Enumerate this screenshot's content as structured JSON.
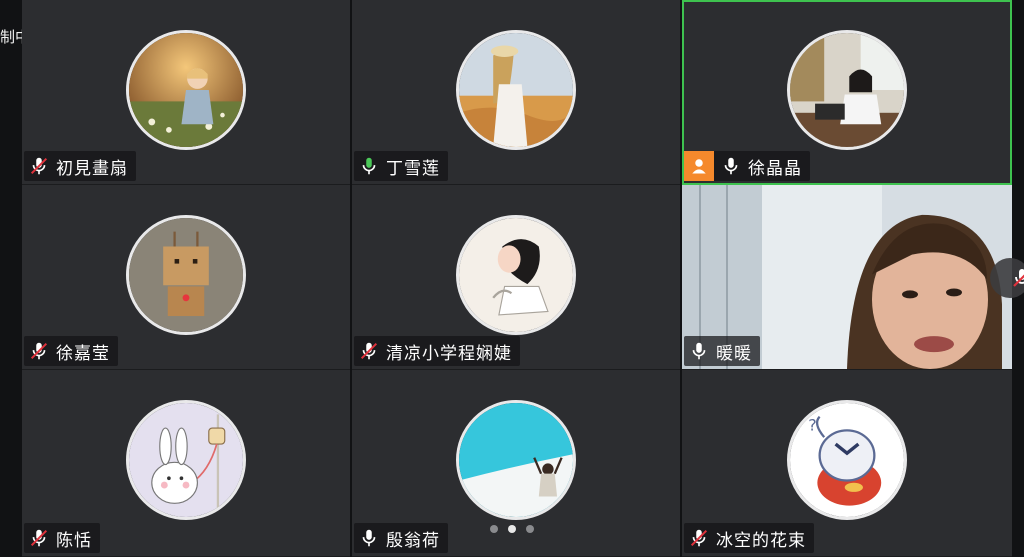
{
  "recording_label": "制中",
  "participants": [
    {
      "name": "初見畫扇",
      "mic": "muted",
      "avatar": "girl-autumn-field"
    },
    {
      "name": "丁雪莲",
      "mic": "on",
      "avatar": "woman-wheat-field"
    },
    {
      "name": "徐晶晶",
      "mic": "on",
      "avatar": "woman-office",
      "host": true,
      "active_speaker": true
    },
    {
      "name": "徐嘉莹",
      "mic": "muted",
      "avatar": "cardboard-robot"
    },
    {
      "name": "清凉小学程娴婕",
      "mic": "muted",
      "avatar": "cartoon-girl-stretch"
    },
    {
      "name": "暖暖",
      "mic": "on",
      "video": "live-camera"
    },
    {
      "name": "陈恬",
      "mic": "muted",
      "avatar": "bunny-drip"
    },
    {
      "name": "殷翁荷",
      "mic": "on",
      "avatar": "beach-figure"
    },
    {
      "name": "冰空的花束",
      "mic": "muted",
      "avatar": "cartoon-dragon"
    }
  ],
  "pager": {
    "pages": 3,
    "current": 2
  },
  "colors": {
    "active_border": "#3ec24f",
    "host_badge": "#f5892c",
    "muted_slash": "#e0323c"
  }
}
